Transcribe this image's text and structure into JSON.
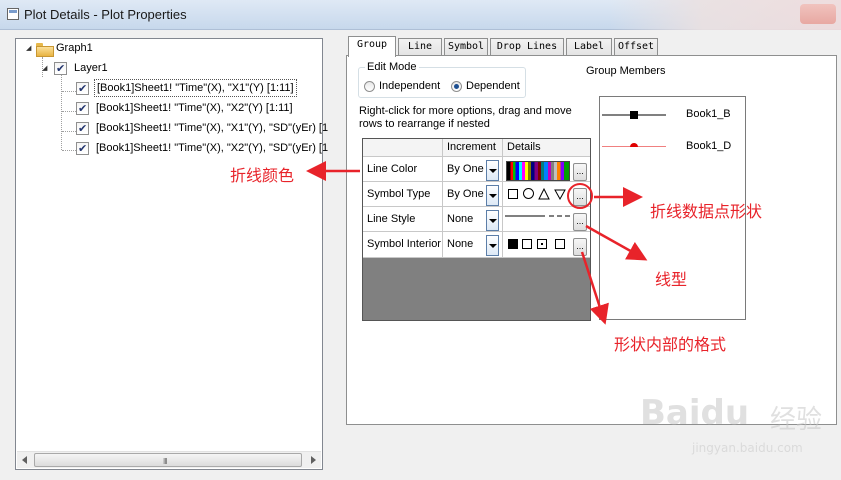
{
  "window": {
    "title": "Plot Details - Plot Properties"
  },
  "tree": {
    "graph": "Graph1",
    "layer": "Layer1",
    "datasets": [
      "[Book1]Sheet1! \"Time\"(X), \"X1\"(Y) [1:11]",
      "[Book1]Sheet1! \"Time\"(X), \"X2\"(Y) [1:11]",
      "[Book1]Sheet1! \"Time\"(X), \"X1\"(Y), \"SD\"(yEr) [1",
      "[Book1]Sheet1! \"Time\"(X), \"X2\"(Y), \"SD\"(yEr) [1"
    ],
    "scroll_grip": "III"
  },
  "tabs": [
    "Group",
    "Line",
    "Symbol",
    "Drop Lines",
    "Label",
    "Offset"
  ],
  "edit_mode": {
    "title": "Edit Mode",
    "independent": "Independent",
    "dependent": "Dependent",
    "selected": "Dependent"
  },
  "hint": {
    "line1": "Right-click for more options, drag and move",
    "line2": "rows to  rearrange if nested"
  },
  "grid": {
    "headers": [
      "",
      "Increment",
      "Details"
    ],
    "rows": [
      {
        "name": "Line Color",
        "increment": "By One"
      },
      {
        "name": "Symbol Type",
        "increment": "By One"
      },
      {
        "name": "Line Style",
        "increment": "None"
      },
      {
        "name": "Symbol Interior",
        "increment": "None"
      }
    ],
    "ellipsis": "..."
  },
  "group_members": {
    "title": "Group Members",
    "items": [
      {
        "name": "Book1_B",
        "color": "#000000"
      },
      {
        "name": "Book1_D",
        "color": "#e00000"
      }
    ]
  },
  "annotations": {
    "line_color": "折线颜色",
    "symbol_shape": "折线数据点形状",
    "line_style": "线型",
    "interior": "形状内部的格式",
    "color": "#e8232a"
  },
  "watermark": {
    "logo": "Baidu",
    "cn": "经验",
    "url": "jingyan.baidu.com"
  }
}
